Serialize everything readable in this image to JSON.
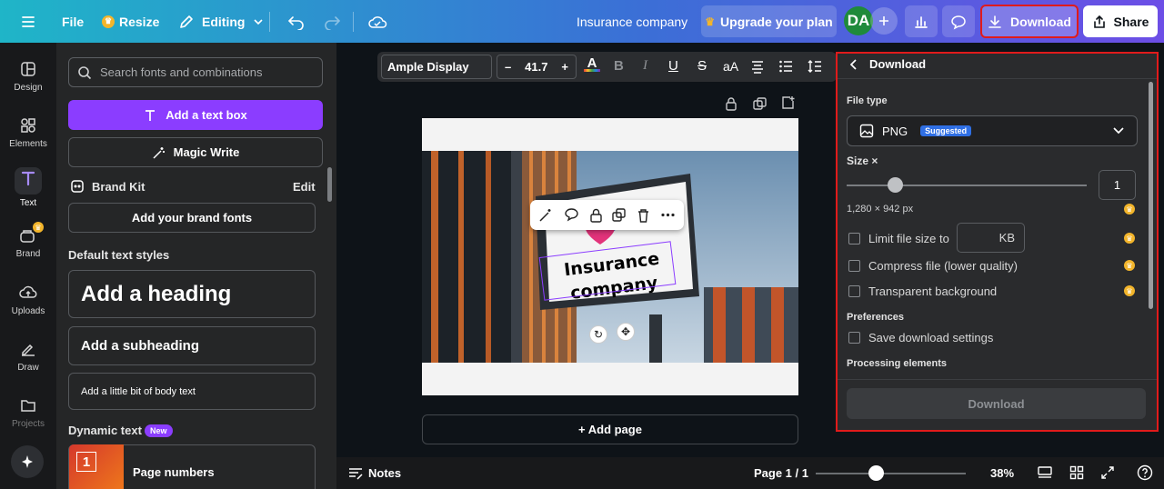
{
  "topbar": {
    "file": "File",
    "resize": "Resize",
    "editing": "Editing",
    "design_title": "Insurance company",
    "upgrade": "Upgrade your plan",
    "avatar": "DA",
    "download": "Download",
    "share": "Share"
  },
  "rail": {
    "design": "Design",
    "elements": "Elements",
    "text": "Text",
    "brand": "Brand",
    "uploads": "Uploads",
    "draw": "Draw",
    "projects": "Projects"
  },
  "panel": {
    "search_placeholder": "Search fonts and combinations",
    "add_text_box": "Add a text box",
    "magic_write": "Magic Write",
    "brand_kit": "Brand Kit",
    "edit": "Edit",
    "add_brand_fonts": "Add your brand fonts",
    "default_styles": "Default text styles",
    "heading": "Add a heading",
    "subheading": "Add a subheading",
    "body": "Add a little bit of body text",
    "dynamic_text": "Dynamic text",
    "new_badge": "New",
    "page_numbers": "Page numbers"
  },
  "toolbar": {
    "font": "Ample Display",
    "minus": "–",
    "size": "41.7",
    "plus": "+",
    "case": "aA"
  },
  "canvas": {
    "sign_text_1": "Insurance",
    "sign_text_2": "company",
    "add_page": "+ Add page"
  },
  "download_panel": {
    "title": "Download",
    "file_type_label": "File type",
    "file_type": "PNG",
    "suggested": "Suggested",
    "size_label": "Size ×",
    "size_value": "1",
    "size_slider_fraction": 0.2,
    "dimensions": "1,280 × 942 px",
    "limit_file_size": "Limit file size to",
    "kb": "KB",
    "compress": "Compress file (lower quality)",
    "transparent": "Transparent background",
    "preferences": "Preferences",
    "save_settings": "Save download settings",
    "processing": "Processing elements",
    "download_button": "Download"
  },
  "bottombar": {
    "notes": "Notes",
    "page": "Page 1 / 1",
    "zoom": "38%",
    "zoom_fraction": 0.4
  },
  "colors": {
    "accent_purple": "#8b3dff",
    "highlight_red": "#e01b1b",
    "avatar_green": "#1f8a3b",
    "crown_gold": "#f3b52b",
    "suggested_blue": "#2f6fe4"
  }
}
